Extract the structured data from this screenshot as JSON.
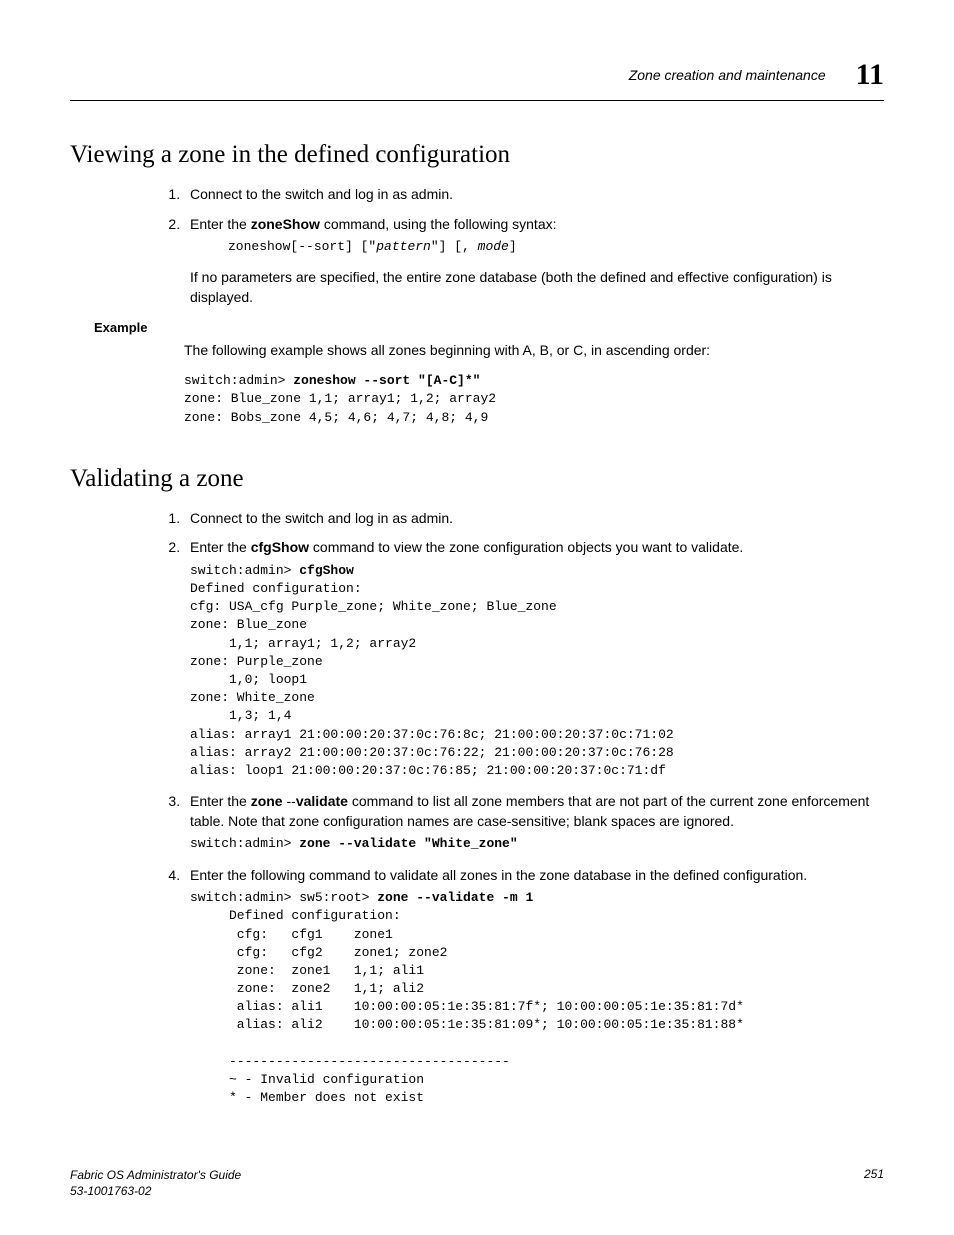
{
  "header": {
    "section_title": "Zone creation and maintenance",
    "chapter_number": "11"
  },
  "section_a": {
    "title": "Viewing a zone in the defined configuration",
    "step1": "Connect to the switch and log in as admin.",
    "step2_prefix": "Enter the ",
    "step2_cmd": "zoneShow",
    "step2_suffix": " command, using the following syntax:",
    "syntax_pre": "zoneshow[--sort] [\"",
    "syntax_pattern": "pattern",
    "syntax_mid": "\"] [, ",
    "syntax_mode": "mode",
    "syntax_post": "]",
    "para": "If no parameters are specified, the entire zone database (both the defined and effective configuration) is displayed.",
    "example_label": "Example",
    "example_intro": "The following example shows all zones beginning with A, B, or C, in ascending order:",
    "example_code_prompt": "switch:admin> ",
    "example_code_cmd": "zoneshow --sort \"[A-C]*\"",
    "example_code_rest": "zone: Blue_zone 1,1; array1; 1,2; array2\nzone: Bobs_zone 4,5; 4,6; 4,7; 4,8; 4,9"
  },
  "section_b": {
    "title": "Validating a zone",
    "step1": "Connect to the switch and log in as admin.",
    "step2_prefix": "Enter the ",
    "step2_cmd": "cfgShow",
    "step2_suffix": " command to view the zone configuration objects you want to validate.",
    "step2_code_prompt": "switch:admin> ",
    "step2_code_cmd": "cfgShow",
    "step2_code_rest": "Defined configuration:\ncfg: USA_cfg Purple_zone; White_zone; Blue_zone\nzone: Blue_zone\n     1,1; array1; 1,2; array2\nzone: Purple_zone\n     1,0; loop1\nzone: White_zone\n     1,3; 1,4\nalias: array1 21:00:00:20:37:0c:76:8c; 21:00:00:20:37:0c:71:02\nalias: array2 21:00:00:20:37:0c:76:22; 21:00:00:20:37:0c:76:28\nalias: loop1 21:00:00:20:37:0c:76:85; 21:00:00:20:37:0c:71:df",
    "step3_prefix": "Enter the ",
    "step3_cmd": "zone",
    "step3_mid": " --",
    "step3_cmd2": "validate",
    "step3_suffix": " command to list all zone members that are not part of the current zone enforcement table. Note that zone configuration names are case-sensitive; blank spaces are ignored.",
    "step3_code_prompt": "switch:admin> ",
    "step3_code_cmd": "zone --validate \"White_zone\"",
    "step4": "Enter the following command to validate all zones in the zone database in the defined configuration.",
    "step4_code_prompt": "switch:admin> sw5:root> ",
    "step4_code_cmd": "zone --validate -m 1",
    "step4_code_rest": "     Defined configuration:\n      cfg:   cfg1    zone1\n      cfg:   cfg2    zone1; zone2\n      zone:  zone1   1,1; ali1\n      zone:  zone2   1,1; ali2\n      alias: ali1    10:00:00:05:1e:35:81:7f*; 10:00:00:05:1e:35:81:7d*\n      alias: ali2    10:00:00:05:1e:35:81:09*; 10:00:00:05:1e:35:81:88*\n\n     ------------------------------------\n     ~ - Invalid configuration\n     * - Member does not exist"
  },
  "footer": {
    "left_line1": "Fabric OS Administrator's Guide",
    "left_line2": "53-1001763-02",
    "page": "251"
  }
}
